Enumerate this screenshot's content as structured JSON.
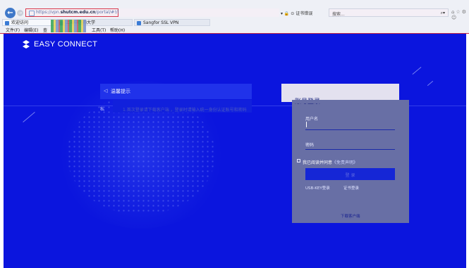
{
  "browser": {
    "url_prefix": "https://vpn.",
    "url_domain": "shutcm.edu.cn",
    "url_suffix": "/portal/#!/login",
    "addr_controls": "▾ 🔒 ⊙ 证书错误",
    "search_placeholder": "搜索...",
    "search_icon": "⌕▾",
    "window_icons": "⌂☆⚙☺",
    "tabs": [
      {
        "label": "欢迎访问"
      },
      {
        "label": "上海中医药大学"
      },
      {
        "label": "Sangfor SSL VPN"
      }
    ],
    "menu": [
      {
        "label": "文件(F)"
      },
      {
        "label": "编辑(E)"
      },
      {
        "label": "查"
      },
      {
        "label": "工具(T)"
      },
      {
        "label": "帮助(H)"
      }
    ]
  },
  "brand": {
    "name": "EASY CONNECT"
  },
  "notice": {
    "title": "温馨提示",
    "fragment": "私",
    "text": "1.首次登录请下载客户端 ，登录时请输入统一身份认证账号和密码"
  },
  "login": {
    "title": "账号登录",
    "username_label": "用户名",
    "password_label": "密码",
    "agree_text": "我已阅读并同意",
    "agree_link": "《免责声明》",
    "login_button": "登 录",
    "usb_key": "USB-KEY登录",
    "cert_login": "证书登录",
    "download_client": "下载客户端"
  },
  "colors": {
    "page_bg": "#0b15de",
    "panel": "#686fa5",
    "accent_red": "#d83a4e"
  }
}
